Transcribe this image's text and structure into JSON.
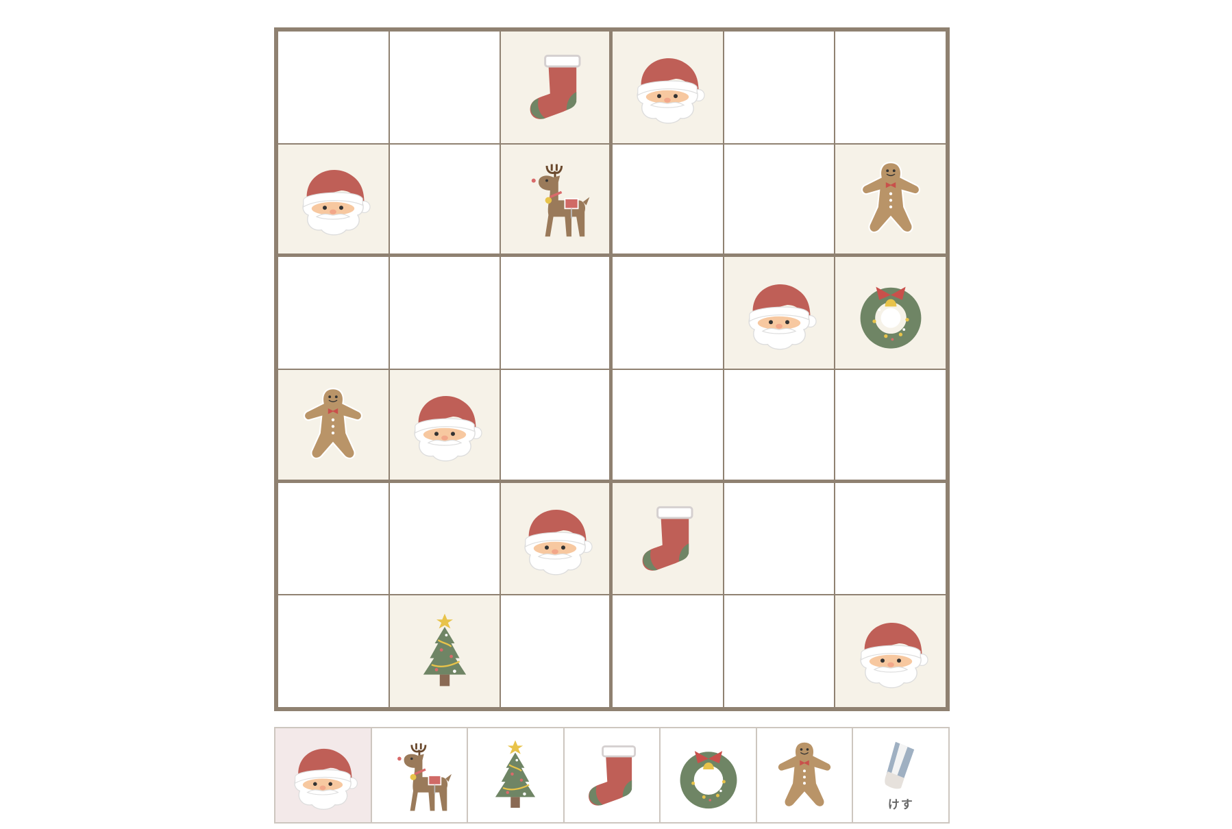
{
  "board": {
    "rows": [
      [
        "",
        "",
        "stocking",
        "santa",
        "",
        ""
      ],
      [
        "santa",
        "",
        "reindeer",
        "",
        "",
        "gingerbread"
      ],
      [
        "",
        "",
        "",
        "",
        "santa",
        "wreath"
      ],
      [
        "gingerbread",
        "santa",
        "",
        "",
        "",
        ""
      ],
      [
        "",
        "",
        "santa",
        "stocking",
        "",
        ""
      ],
      [
        "",
        "tree",
        "",
        "",
        "",
        "santa"
      ]
    ]
  },
  "palette": {
    "selected": "santa",
    "items": [
      {
        "icon": "santa",
        "label": ""
      },
      {
        "icon": "reindeer",
        "label": ""
      },
      {
        "icon": "tree",
        "label": ""
      },
      {
        "icon": "stocking",
        "label": ""
      },
      {
        "icon": "wreath",
        "label": ""
      },
      {
        "icon": "gingerbread",
        "label": ""
      },
      {
        "icon": "eraser",
        "label": "けす"
      }
    ]
  },
  "colors": {
    "grid_line": "#8f8171",
    "given_cell": "#f6f2e8",
    "selected_palette": "#f3e9e9",
    "santa_red": "#bf5f57",
    "green": "#6f8565",
    "brown": "#9a7a5a"
  }
}
